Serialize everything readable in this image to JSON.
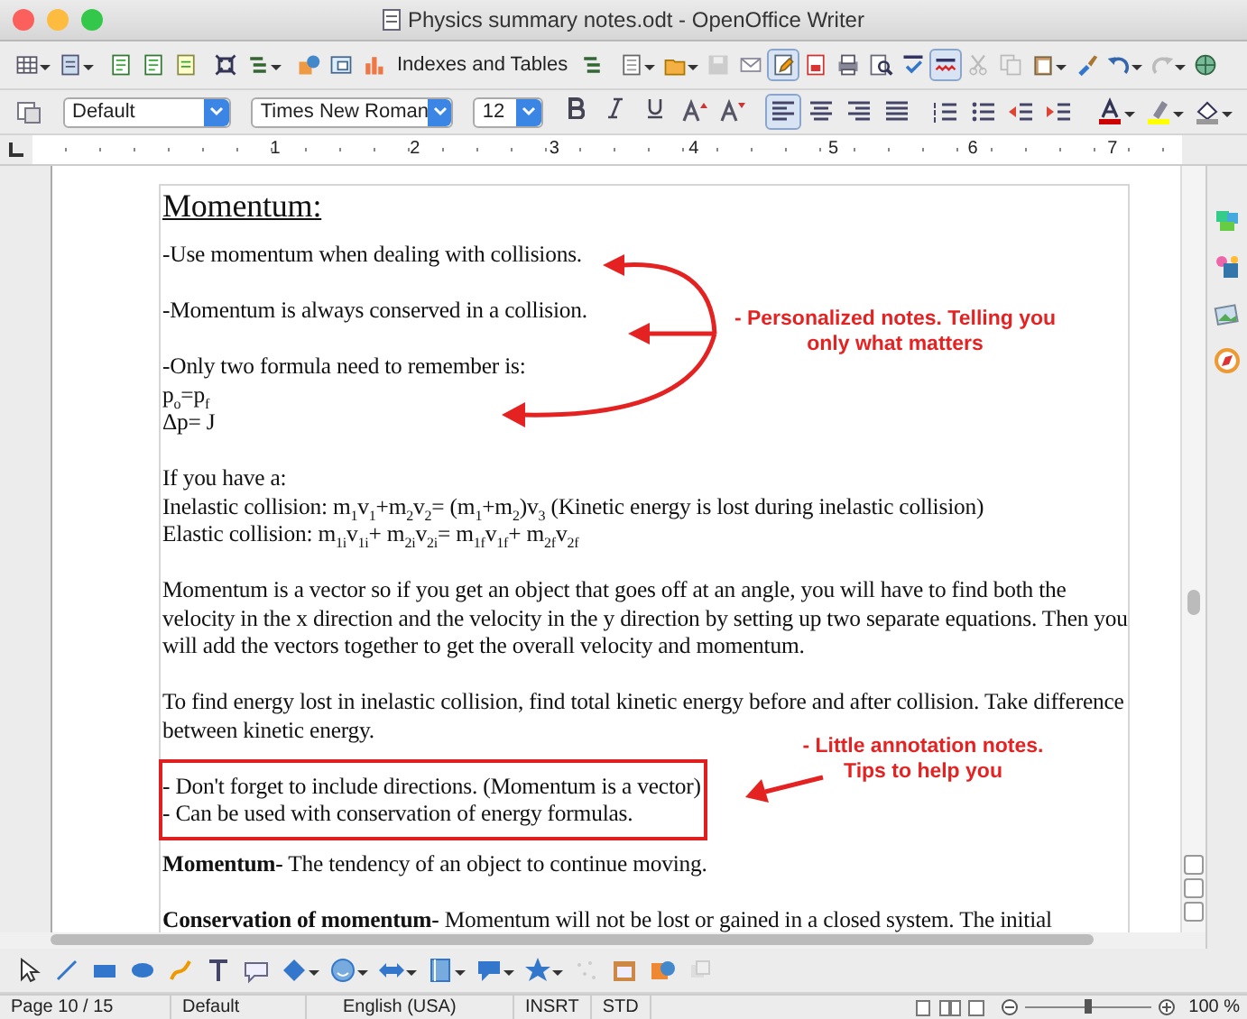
{
  "window": {
    "title": "Physics summary notes.odt - OpenOffice Writer"
  },
  "standard_toolbar": {
    "indexes_label": "Indexes and Tables",
    "edit_mode": true,
    "auto_spellcheck": true
  },
  "formatting_toolbar": {
    "paragraph_style": "Default",
    "font_name": "Times New Roman",
    "font_size": "12",
    "bold": false,
    "italic": false,
    "underline": false,
    "alignments": [
      {
        "kind": "left",
        "selected": true
      },
      {
        "kind": "center",
        "selected": false
      },
      {
        "kind": "right",
        "selected": false
      },
      {
        "kind": "justify",
        "selected": false
      }
    ]
  },
  "ruler": {
    "marks": [
      "1",
      "2",
      "3",
      "4",
      "5",
      "6",
      "7"
    ]
  },
  "document": {
    "blocks": [
      {
        "kind": "heading",
        "lines": [
          "Momentum:"
        ]
      },
      {
        "kind": "text",
        "lines": [
          "-Use momentum when dealing with collisions."
        ]
      },
      {
        "kind": "text",
        "lines": [
          "-Momentum is always conserved in a collision."
        ]
      },
      {
        "kind": "text",
        "lines": [
          "-Only two formula need to remember is:",
          "p$_{o}$=p$_{f}$",
          "Δp= J"
        ]
      },
      {
        "kind": "text",
        "lines": [
          "If you have a:",
          "Inelastic collision: m$_{1}$v$_{1}$+m$_{2}$v$_{2}$= (m$_{1}$+m$_{2}$)v$_{3}$ (Kinetic energy is lost during inelastic collision)",
          "Elastic collision: m$_{1i}$v$_{1i}$+ m$_{2i}$v$_{2i}$= m$_{1f}$v$_{1f}$+ m$_{2f}$v$_{2f}$"
        ]
      },
      {
        "kind": "text",
        "lines": [
          "Momentum is a vector so if you get an object that goes off at an angle, you will have to find both the velocity in the x direction and the velocity in the y direction by setting up two separate equations. Then you will add the vectors together to get the overall velocity and momentum."
        ]
      },
      {
        "kind": "text",
        "lines": [
          "To find energy lost in inelastic collision, find total kinetic energy before and after collision. Take difference between kinetic energy."
        ]
      },
      {
        "kind": "boxed",
        "lines": [
          "- Don't forget to include directions. (Momentum is a vector)",
          "- Can be used with conservation of energy formulas."
        ]
      },
      {
        "kind": "text",
        "lines": [
          "**Momentum-** The tendency of an object to continue moving."
        ]
      },
      {
        "kind": "text",
        "lines": [
          "**Conservation of momentum-** Momentum will not be lost or gained in a closed system. The initial"
        ]
      }
    ]
  },
  "annotations": [
    {
      "text": "- Personalized notes. Telling you only what matters"
    },
    {
      "text": "- Little annotation notes. Tips to help you"
    }
  ],
  "status_bar": {
    "page": "Page 10 / 15",
    "page_style": "Default",
    "language": "English (USA)",
    "insert_mode": "INSRT",
    "selection_mode": "STD",
    "zoom": {
      "level": 0.5,
      "label": "100 %"
    }
  }
}
